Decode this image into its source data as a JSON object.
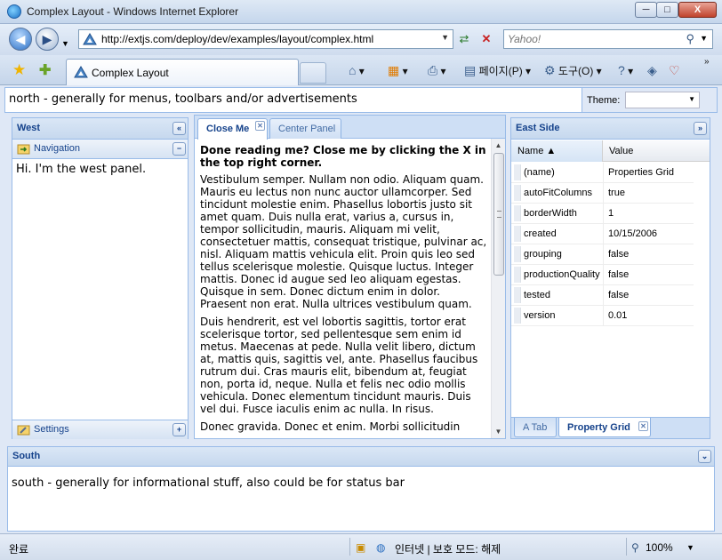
{
  "window": {
    "title": "Complex Layout - Windows Internet Explorer",
    "minimize": "─",
    "maximize": "□",
    "close": "X"
  },
  "addressbar": {
    "url": "http://extjs.com/deploy/dev/examples/layout/complex.html",
    "search_placeholder": "Yahoo!"
  },
  "tabs": {
    "active_title": "Complex Layout"
  },
  "commands": {
    "page": "페이지(P)",
    "tools": "도구(O)"
  },
  "north": {
    "text": "north - generally for menus, toolbars and/or advertisements",
    "theme_label": "Theme:",
    "theme_value": ""
  },
  "west": {
    "title": "West",
    "navigation_label": "Navigation",
    "body": "Hi. I'm the west panel.",
    "settings_label": "Settings"
  },
  "center": {
    "tabs": [
      {
        "label": "Close Me"
      },
      {
        "label": "Center Panel"
      }
    ],
    "heading": "Done reading me? Close me by clicking the X in the top right corner.",
    "paragraphs": [
      "Vestibulum semper. Nullam non odio. Aliquam quam. Mauris eu lectus non nunc auctor ullamcorper. Sed tincidunt molestie enim. Phasellus lobortis justo sit amet quam. Duis nulla erat, varius a, cursus in, tempor sollicitudin, mauris. Aliquam mi velit, consectetuer mattis, consequat tristique, pulvinar ac, nisl. Aliquam mattis vehicula elit. Proin quis leo sed tellus scelerisque molestie. Quisque luctus. Integer mattis. Donec id augue sed leo aliquam egestas. Quisque in sem. Donec dictum enim in dolor. Praesent non erat. Nulla ultrices vestibulum quam.",
      "Duis hendrerit, est vel lobortis sagittis, tortor erat scelerisque tortor, sed pellentesque sem enim id metus. Maecenas at pede. Nulla velit libero, dictum at, mattis quis, sagittis vel, ante. Phasellus faucibus rutrum dui. Cras mauris elit, bibendum at, feugiat non, porta id, neque. Nulla et felis nec odio mollis vehicula. Donec elementum tincidunt mauris. Duis vel dui. Fusce iaculis enim ac nulla. In risus.",
      "Donec gravida. Donec et enim. Morbi sollicitudin"
    ]
  },
  "east": {
    "title": "East Side",
    "grid": {
      "columns": [
        "Name ▲",
        "Value"
      ],
      "rows": [
        {
          "name": "(name)",
          "value": "Properties Grid"
        },
        {
          "name": "autoFitColumns",
          "value": "true"
        },
        {
          "name": "borderWidth",
          "value": "1"
        },
        {
          "name": "created",
          "value": "10/15/2006"
        },
        {
          "name": "grouping",
          "value": "false"
        },
        {
          "name": "productionQuality",
          "value": "false"
        },
        {
          "name": "tested",
          "value": "false"
        },
        {
          "name": "version",
          "value": "0.01"
        }
      ]
    },
    "tabs": [
      {
        "label": "A Tab"
      },
      {
        "label": "Property Grid"
      }
    ]
  },
  "south": {
    "title": "South",
    "body": "south - generally for informational stuff, also could be for status bar"
  },
  "status": {
    "left": "완료",
    "zone": "인터넷 | 보호 모드: 해제",
    "zoom": "100%"
  },
  "colors": {
    "header_text": "#15428b",
    "border": "#99bbe8",
    "panel_bg": "#dfe8f6"
  }
}
